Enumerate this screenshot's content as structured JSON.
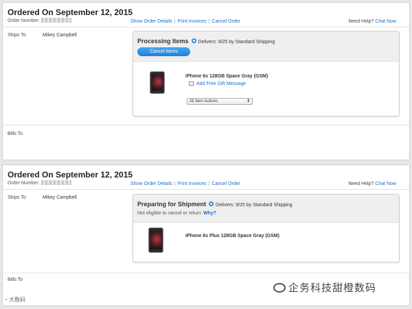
{
  "orders": [
    {
      "ordered_on": "Ordered On September 12, 2015",
      "order_number_label": "Order Number:",
      "links": {
        "show_details": "Show Order Details",
        "print": "Print Invoices",
        "cancel": "Cancel Order"
      },
      "help": {
        "label": "Need Help?",
        "chat": "Chat Now"
      },
      "ships_to_label": "Ships To",
      "ships_to_name": "Mikey Campbell",
      "status": "Processing Items",
      "delivers": "Delivers: 9/25 by Standard Shipping",
      "cancel_items_button": "Cancel Items",
      "product": "iPhone 6s 128GB Space Gray (GSM)",
      "gift_message": "Add Free Gift Message",
      "actions_select": "All Item Actions",
      "bills_to_label": "Bills To"
    },
    {
      "ordered_on": "Ordered On September 12, 2015",
      "order_number_label": "Order Number:",
      "links": {
        "show_details": "Show Order Details",
        "print": "Print Invoices",
        "cancel": "Cancel Order"
      },
      "help": {
        "label": "Need Help?",
        "chat": "Chat Now"
      },
      "ships_to_label": "Ships To",
      "ships_to_name": "Mikey Campbell",
      "status": "Preparing for Shipment",
      "delivers": "Delivers: 9/25 by Standard Shipping",
      "note": "Not eligible to cancel or return",
      "why_link": "Why?",
      "product": "iPhone 6s Plus 128GB Space Gray (GSM)",
      "bills_to_label": "Bills To"
    }
  ],
  "watermark": {
    "text": "企务科技甜橙数码",
    "corner": "大数码"
  },
  "colors": {
    "link": "#1a6ecc",
    "button": "#2b8ae0",
    "status_dot": "#2b8ae0"
  }
}
